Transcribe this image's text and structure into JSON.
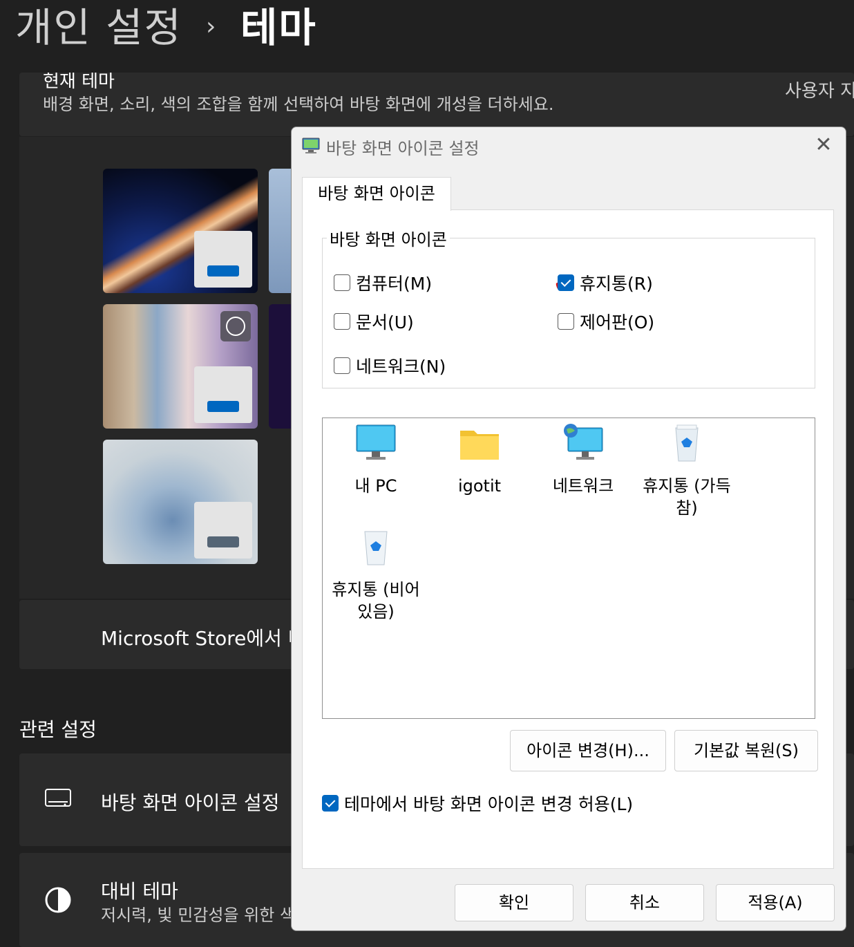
{
  "breadcrumb": {
    "parent": "개인 설정",
    "separator": "›",
    "current": "테마"
  },
  "current_theme": {
    "title": "현재 테마",
    "description": "배경 화면, 소리, 색의 조합을 함께 선택하여 바탕 화면에 개성을 더하세요.",
    "right_label": "사용자 지정"
  },
  "store_row": {
    "label": "Microsoft Store에서 더 많은 테마 가져오기"
  },
  "related": {
    "heading": "관련 설정",
    "desktop_icons": {
      "title": "바탕 화면 아이콘 설정"
    },
    "contrast": {
      "title": "대비 테마",
      "subtitle": "저시력, 빛 민감성을 위한 색 테마"
    }
  },
  "dialog": {
    "title": "바탕 화면 아이콘 설정",
    "close": "✕",
    "tab": "바탕 화면 아이콘",
    "group_label": "바탕 화면 아이콘",
    "checkboxes": [
      {
        "label": "컴퓨터(M)",
        "checked": false
      },
      {
        "label": "휴지통(R)",
        "checked": true
      },
      {
        "label": "문서(U)",
        "checked": false
      },
      {
        "label": "제어판(O)",
        "checked": false
      },
      {
        "label": "네트워크(N)",
        "checked": false
      }
    ],
    "annotation_mark": "✔",
    "icons": [
      {
        "label": "내 PC",
        "icon": "monitor-icon"
      },
      {
        "label": "igotit",
        "icon": "folder-icon"
      },
      {
        "label": "네트워크",
        "icon": "network-icon"
      },
      {
        "label": "휴지통 (가득 참)",
        "icon": "recycle-bin-full-icon"
      },
      {
        "label": "휴지통 (비어 있음)",
        "icon": "recycle-bin-empty-icon"
      }
    ],
    "change_icon_button": "아이콘 변경(H)...",
    "restore_default_button": "기본값 복원(S)",
    "allow_themes": {
      "label": "테마에서 바탕 화면 아이콘 변경 허용(L)",
      "checked": true
    },
    "ok_button": "확인",
    "cancel_button": "취소",
    "apply_button": "적용(A)"
  },
  "colors": {
    "accent": "#0067c0",
    "background": "#202020",
    "card": "#2b2b2b",
    "annotation": "#e01010"
  }
}
